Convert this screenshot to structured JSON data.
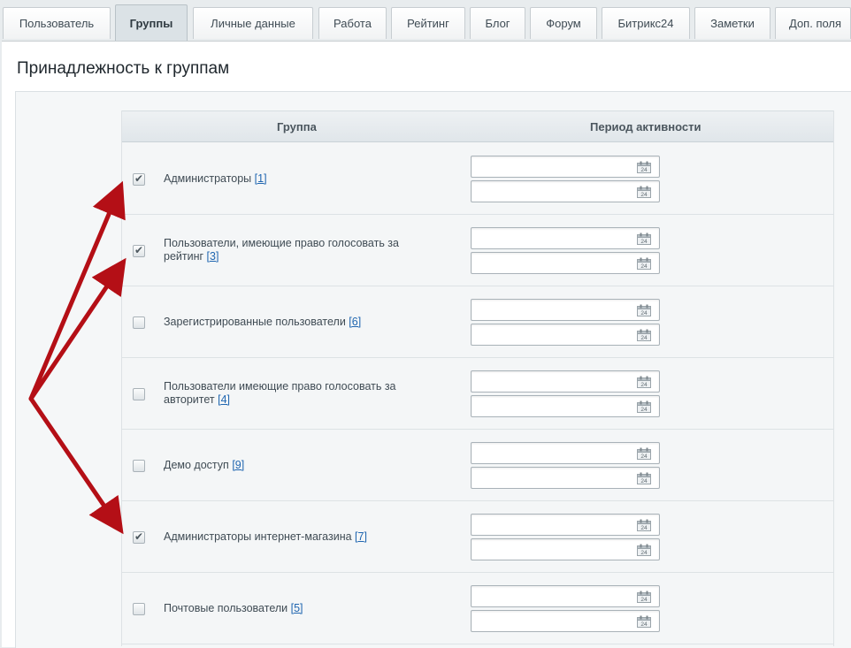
{
  "tabs": [
    {
      "label": "Пользователь",
      "active": false
    },
    {
      "label": "Группы",
      "active": true
    },
    {
      "label": "Личные данные",
      "active": false
    },
    {
      "label": "Работа",
      "active": false
    },
    {
      "label": "Рейтинг",
      "active": false
    },
    {
      "label": "Блог",
      "active": false
    },
    {
      "label": "Форум",
      "active": false
    },
    {
      "label": "Битрикс24",
      "active": false
    },
    {
      "label": "Заметки",
      "active": false
    },
    {
      "label": "Доп. поля",
      "active": false
    }
  ],
  "section_title": "Принадлежность к группам",
  "table": {
    "col_group": "Группа",
    "col_period": "Период активности",
    "rows": [
      {
        "name": "Администраторы",
        "id": "[1]",
        "checked": true
      },
      {
        "name": "Пользователи, имеющие право голосовать за рейтинг",
        "id": "[3]",
        "checked": true
      },
      {
        "name": "Зарегистрированные пользователи",
        "id": "[6]",
        "checked": false
      },
      {
        "name": "Пользователи имеющие право голосовать за авторитет",
        "id": "[4]",
        "checked": false
      },
      {
        "name": "Демо доступ",
        "id": "[9]",
        "checked": false
      },
      {
        "name": "Администраторы интернет-магазина",
        "id": "[7]",
        "checked": true
      },
      {
        "name": "Почтовые пользователи",
        "id": "[5]",
        "checked": false
      }
    ]
  },
  "calendar_icon_text": "24",
  "colors": {
    "arrow": "#b40f16",
    "link": "#2066b0",
    "active_tab": "#dbe2e6"
  }
}
